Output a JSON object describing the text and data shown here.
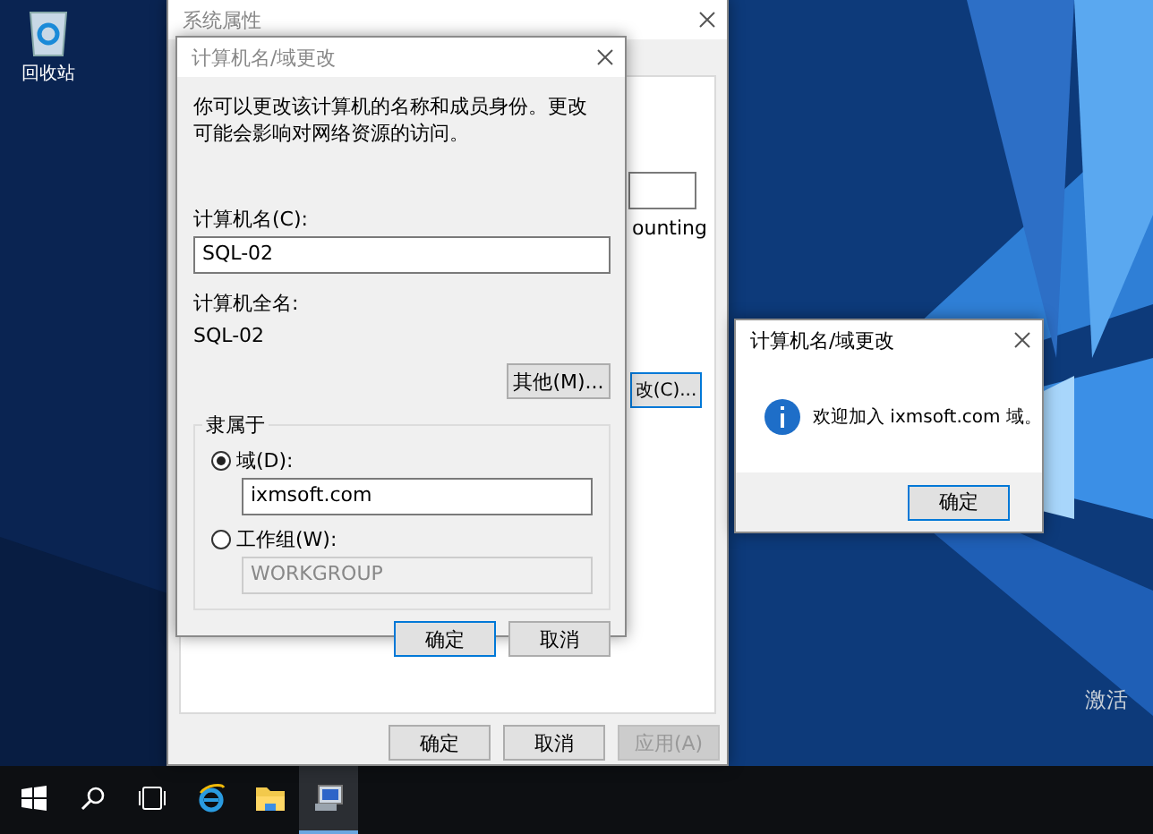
{
  "desktop": {
    "icons": [
      {
        "label": "回收站"
      }
    ],
    "activation_text": "激活"
  },
  "system_properties": {
    "title": "系统属性",
    "partial_text": "ounting",
    "partial_button": "改(C)...",
    "buttons": [
      {
        "label": "确定",
        "disabled": false
      },
      {
        "label": "取消",
        "disabled": false
      },
      {
        "label": "应用(A)",
        "disabled": true
      }
    ]
  },
  "name_dialog": {
    "title": "计算机名/域更改",
    "description": "你可以更改该计算机的名称和成员身份。更改可能会影响对网络资源的访问。",
    "computer_name_label": "计算机名(C):",
    "computer_name": "SQL-02",
    "full_name_label": "计算机全名:",
    "full_name": "SQL-02",
    "more_button": "其他(M)...",
    "member_of": {
      "title": "隶属于",
      "options": [
        {
          "label": "域(D):",
          "selected": true,
          "value": "ixmsoft.com",
          "disabled": false
        },
        {
          "label": "工作组(W):",
          "selected": false,
          "value": "WORKGROUP",
          "disabled": true
        }
      ]
    },
    "buttons": [
      {
        "label": "确定",
        "default": true
      },
      {
        "label": "取消",
        "default": false
      }
    ]
  },
  "message_box": {
    "title": "计算机名/域更改",
    "message": "欢迎加入 ixmsoft.com 域。",
    "button": "确定"
  },
  "taskbar": {
    "items": [
      {
        "kind": "start",
        "selected": false
      },
      {
        "kind": "search",
        "selected": false
      },
      {
        "kind": "task_view",
        "selected": false
      },
      {
        "kind": "browser",
        "selected": false
      },
      {
        "kind": "folder",
        "selected": false
      },
      {
        "kind": "system",
        "selected": true
      }
    ]
  }
}
